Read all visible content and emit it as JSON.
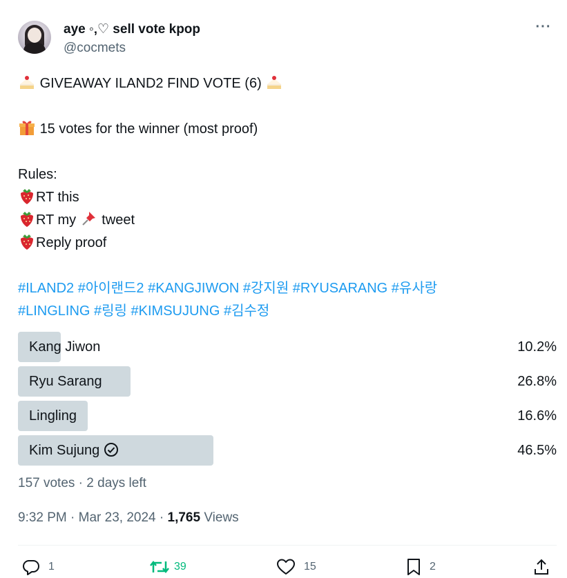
{
  "author": {
    "display_name": "aye ◦‚♡ sell vote kpop",
    "handle": "@cocmets"
  },
  "tweet": {
    "title_line": "GIVEAWAY ILAND2 FIND VOTE (6)",
    "prize_line": "15 votes for the winner (most proof)",
    "rules_heading": "Rules:",
    "rule_1": "RT this",
    "rule_2_pre": "RT my",
    "rule_2_post": "tweet",
    "rule_3": "Reply proof",
    "hashtags_line1": "#ILAND2 #아이랜드2 #KANGJIWON #강지원 #RYUSARANG #유사랑",
    "hashtags_line2": "#LINGLING #링링 #KIMSUJUNG #김수정"
  },
  "poll": {
    "options": [
      {
        "label": "Kang Jiwon",
        "percent": "10.2%",
        "fraction": 0.102,
        "winner": false
      },
      {
        "label": "Ryu Sarang",
        "percent": "26.8%",
        "fraction": 0.268,
        "winner": false
      },
      {
        "label": "Lingling",
        "percent": "16.6%",
        "fraction": 0.166,
        "winner": false
      },
      {
        "label": "Kim Sujung",
        "percent": "46.5%",
        "fraction": 0.465,
        "winner": true
      }
    ],
    "meta": "157 votes · 2 days left"
  },
  "timestamp": {
    "time": "9:32 PM · Mar 23, 2024 · ",
    "views_count": "1,765",
    "views_label": " Views"
  },
  "actions": {
    "replies": "1",
    "retweets": "39",
    "likes": "15",
    "bookmarks": "2"
  },
  "colors": {
    "link": "#1d9bf0",
    "retweet": "#00ba7c",
    "muted": "#536471",
    "poll_bar": "#cfd9de"
  }
}
